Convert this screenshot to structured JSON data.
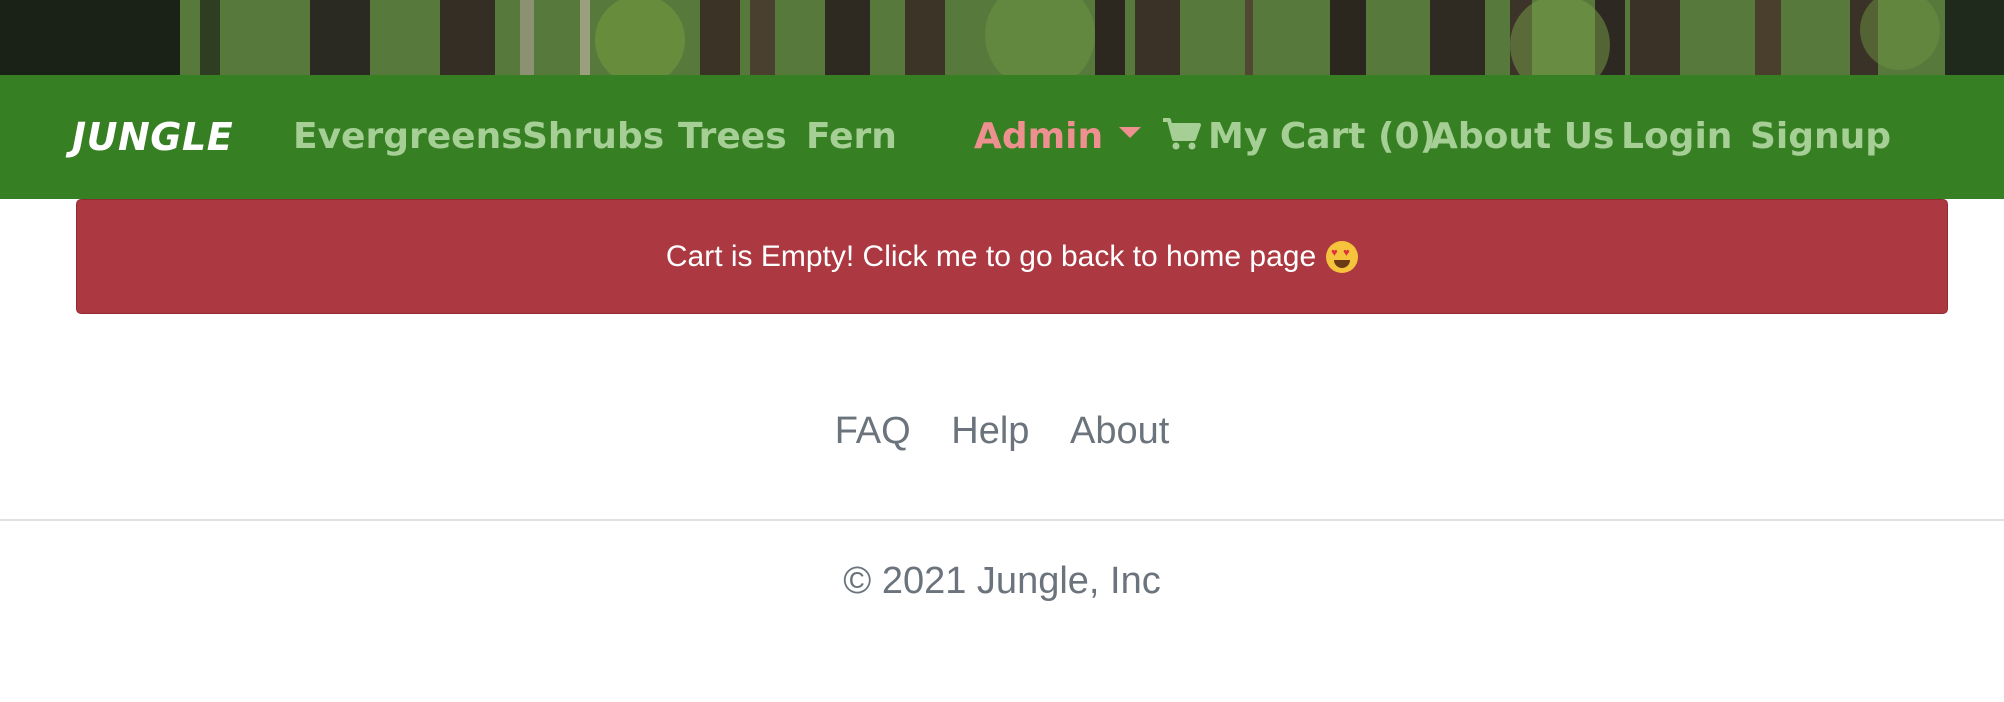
{
  "brand": "JUNGLE",
  "nav": {
    "links": [
      "Evergreens",
      "Shrubs",
      "Trees",
      "Fern"
    ],
    "admin_label": "Admin",
    "cart_label": "My Cart (0)",
    "about_label": "About Us",
    "login_label": "Login",
    "signup_label": "Signup"
  },
  "alert": {
    "message": "Cart is Empty! Click me to go back to home page"
  },
  "footer": {
    "links": [
      "FAQ",
      "Help",
      "About"
    ],
    "copyright": "© 2021 Jungle, Inc"
  },
  "colors": {
    "navbar": "#367f23",
    "nav_link": "#a5cf94",
    "admin_link": "#ef9090",
    "alert_bg": "#ac3941",
    "footer_text": "#6b737c"
  },
  "icons": [
    "cart-icon",
    "caret-down-icon",
    "heart-eyes-emoji-icon"
  ]
}
